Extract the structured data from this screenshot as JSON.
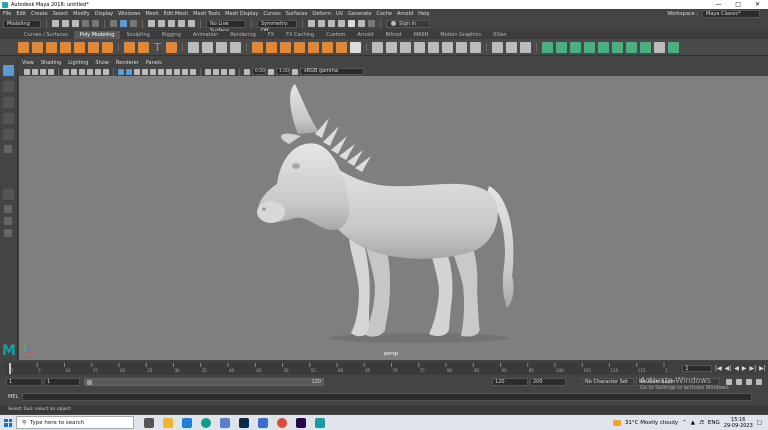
{
  "window": {
    "title": "Autodesk Maya 2018: untitled*",
    "controls": [
      "—",
      "□",
      "✕"
    ]
  },
  "menubar": {
    "items": [
      "File",
      "Edit",
      "Create",
      "Select",
      "Modify",
      "Display",
      "Windows",
      "Mesh",
      "Edit Mesh",
      "Mesh Tools",
      "Mesh Display",
      "Curves",
      "Surfaces",
      "Deform",
      "UV",
      "Generate",
      "Cache",
      "Arnold",
      "Help"
    ],
    "workspace_label": "Workspace :",
    "workspace_value": "Maya Classic*"
  },
  "statusline": {
    "mode": "Modeling",
    "live_surface": "No Live Surface",
    "symmetry": "Symmetry: Off",
    "sign_in": "Sign In"
  },
  "shelf": {
    "tabs": [
      "Curves / Surfaces",
      "Poly Modeling",
      "Sculpting",
      "Rigging",
      "Animation",
      "Rendering",
      "FX",
      "FX Caching",
      "Custom",
      "Arnold",
      "Bifrost",
      "MASH",
      "Motion Graphics",
      "XGen"
    ],
    "active_tab": "Poly Modeling",
    "text_icon": "T"
  },
  "panel": {
    "menu": [
      "View",
      "Shading",
      "Lighting",
      "Show",
      "Renderer",
      "Panels"
    ],
    "field_a": "0.00",
    "field_b": "1.00",
    "color_space": "sRGB gamma",
    "camera_label": "persp"
  },
  "timeslider": {
    "ticks": [
      "1",
      "5",
      "10",
      "15",
      "20",
      "25",
      "30",
      "35",
      "40",
      "45",
      "50",
      "55",
      "60",
      "65",
      "70",
      "75",
      "80",
      "85",
      "90",
      "95",
      "100",
      "105",
      "110",
      "115",
      "120"
    ],
    "current_frame": "1",
    "controls": [
      "|◀",
      "◀|",
      "◀",
      "▶",
      "▶|",
      "▶|"
    ]
  },
  "rangeslider": {
    "start_time": "1",
    "playback_start": "1",
    "range_start_label": "1",
    "range_end_label": "120",
    "playback_end": "120",
    "end_time": "200",
    "character_set": "No Character Set",
    "anim_layer": "No Anim Layer"
  },
  "command": {
    "label": "MEL",
    "help_text": "Select Tool: select an object"
  },
  "watermark": {
    "line1": "Activate Windows",
    "line2": "Go to Settings to activate Windows."
  },
  "taskbar": {
    "search_placeholder": "Type here to search",
    "weather": "31°C  Mostly cloudy",
    "language": "ENG",
    "time": "15:16",
    "date": "29-09-2023"
  },
  "colors": {
    "viewport_bg": "#7f7f7f",
    "accent": "#5b9bd5",
    "maya_logo": "#18a0a0"
  }
}
